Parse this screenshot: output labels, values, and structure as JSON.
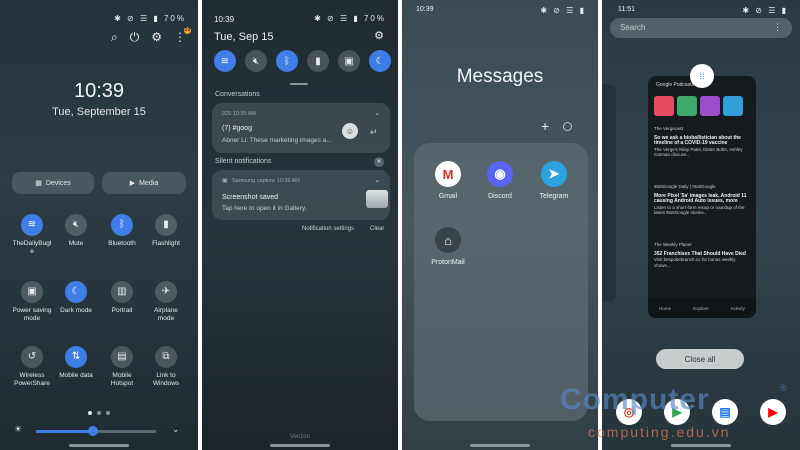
{
  "panel1": {
    "status_percent": "70%",
    "notif_count": "29",
    "time": "10:39",
    "date": "Tue, September 15",
    "devices_label": "Devices",
    "media_label": "Media",
    "tiles": [
      {
        "label": "TheDailyBugl e",
        "icon": "wifi-icon",
        "on": true
      },
      {
        "label": "Mute",
        "icon": "mute-icon",
        "on": false
      },
      {
        "label": "Bluetooth",
        "icon": "bluetooth-icon",
        "on": true
      },
      {
        "label": "Flashlight",
        "icon": "flashlight-icon",
        "on": false
      },
      {
        "label": "Power saving mode",
        "icon": "power-saving-icon",
        "on": false
      },
      {
        "label": "Dark mode",
        "icon": "moon-icon",
        "on": true
      },
      {
        "label": "Portrait",
        "icon": "portrait-icon",
        "on": false
      },
      {
        "label": "Airplane mode",
        "icon": "airplane-icon",
        "on": false
      },
      {
        "label": "Wireless PowerShare",
        "icon": "powershare-icon",
        "on": false
      },
      {
        "label": "Mobile data",
        "icon": "mobile-data-icon",
        "on": true
      },
      {
        "label": "Mobile Hotspot",
        "icon": "hotspot-icon",
        "on": false
      },
      {
        "label": "Link to Windows",
        "icon": "link-windows-icon",
        "on": false
      }
    ]
  },
  "panel2": {
    "time": "10:39",
    "status_percent": "70%",
    "date": "Tue, Sep 15",
    "conversations_title": "Conversations",
    "convo_meta": "925  10:39 AM",
    "convo_title": "(7) #goog",
    "convo_text": "Abner Li: These marketing images a...",
    "silent_title": "Silent notifications",
    "capture_meta": "Samsung capture  10:39 AM",
    "capture_title": "Screenshot saved",
    "capture_text": "Tap here to open it in Gallery.",
    "notif_settings": "Notification settings",
    "clear": "Clear",
    "ghost_text": "Verizon"
  },
  "panel3": {
    "time": "10:39",
    "title": "Messages",
    "apps": [
      {
        "label": "Gmail",
        "icon": "gmail-icon",
        "glyph": "M",
        "bg": "#ffffff",
        "fg": "#d93025"
      },
      {
        "label": "Discord",
        "icon": "discord-icon",
        "glyph": "◉",
        "bg": "#5865f2",
        "fg": "#ffffff"
      },
      {
        "label": "Telegram",
        "icon": "telegram-icon",
        "glyph": "➤",
        "bg": "#2aa3e0",
        "fg": "#ffffff"
      },
      {
        "label": "ProtonMail",
        "icon": "protonmail-icon",
        "glyph": "⌂",
        "bg": "#3a4349",
        "fg": "#ffffff"
      }
    ]
  },
  "panel4": {
    "time": "11:51",
    "search_placeholder": "Search",
    "app_head": "Google Podcasts",
    "episodes": [
      {
        "show": "The Vergecast",
        "title": "So we ask a bioballistician about the timeline of a COVID-19 vaccine",
        "desc": "The Verge's Nilay Patel, Dieter Bohn, Ashley Carman discuss..."
      },
      {
        "show": "9to5Google Daily | 9to5Google",
        "title": "More Pixel '5a' images leak, Android 11 causing Android Auto issues, more",
        "desc": "Listen to a short-form recap or roundup of the latest 9to5Google stories..."
      },
      {
        "show": "The Weekly Planet",
        "title": "352 Franchises That Should Have Died",
        "desc": "Visit bespokebranch.co for bonus weekly shows..."
      }
    ],
    "nav": [
      "Home",
      "Explore",
      "Activity"
    ],
    "close_all": "Close all",
    "dock": [
      {
        "icon": "chrome-icon",
        "glyph": "◎",
        "bg": "#ffffff",
        "fg": "#db4437"
      },
      {
        "icon": "play-store-icon",
        "glyph": "▶",
        "bg": "#ffffff",
        "fg": "#34a853"
      },
      {
        "icon": "news-icon",
        "glyph": "▤",
        "bg": "#ffffff",
        "fg": "#1a73e8"
      },
      {
        "icon": "youtube-icon",
        "glyph": "▶",
        "bg": "#ffffff",
        "fg": "#ff0000"
      }
    ]
  },
  "watermark": {
    "brand": "Computer",
    "sub": "computing.edu.vn",
    "reg": "®"
  }
}
